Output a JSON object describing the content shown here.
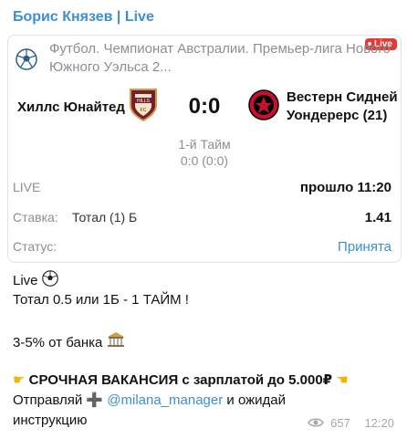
{
  "channel": {
    "title": "Борис Князев | Live"
  },
  "match": {
    "live_badge": "Live",
    "league": "Футбол. Чемпионат Австралии. Премьер-лига Нового Южного Уэльса 2...",
    "team_home": "Хиллс Юнайтед",
    "team_away_line1": "Вестерн Сидней",
    "team_away_line2": "Уондерерс (21)",
    "score": "0:0",
    "period": "1-й Тайм",
    "period_score": "0:0 (0:0)",
    "status_live": "LIVE",
    "elapsed": "прошло 11:20",
    "bet_label": "Ставка:",
    "bet_value": "Тотал (1) Б",
    "odds": "1.41",
    "status_label": "Статус:",
    "status_value": "Принята"
  },
  "message": {
    "line1": "Live",
    "line2": "Тотал 0.5 или 1Б - 1 ТАЙМ !",
    "line3": "3-5% от банка",
    "line4": "СРОЧНАЯ ВАКАНСИЯ с зарплатой до 5.000₽",
    "line5_prefix": "Отправляй",
    "line5_mention": "@milana_manager",
    "line5_suffix": "и ожидай",
    "line6": "инструкцию"
  },
  "footer": {
    "views": "657",
    "time": "12:20"
  },
  "colors": {
    "accent": "#3d8fd1",
    "live": "#e53935",
    "muted": "#8a8f95"
  },
  "icons": [
    "soccer-ball-icon",
    "hills-united-logo-icon",
    "western-sydney-logo-icon",
    "bank-icon",
    "point-right-icon",
    "point-left-icon",
    "plus-icon",
    "eye-icon"
  ]
}
